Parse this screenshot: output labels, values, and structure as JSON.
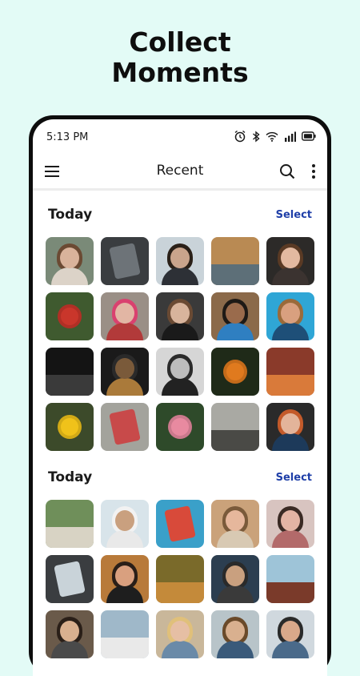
{
  "headline": {
    "line1": "Collect",
    "line2": "Moments"
  },
  "status_bar": {
    "time": "5:13 PM"
  },
  "app_bar": {
    "title": "Recent"
  },
  "sections": [
    {
      "label": "Today",
      "select_label": "Select"
    },
    {
      "label": "Today",
      "select_label": "Select"
    }
  ],
  "colors": {
    "background": "#e3fbf6",
    "phone_frame": "#0d0d0d",
    "select_accent": "#1f3fa8"
  },
  "photos": {
    "section1": [
      {
        "kind": "portrait",
        "bg": "#7a8a78",
        "skin": "#d9b39b",
        "hair": "#6b4a33",
        "shirt": "#dcd3c8"
      },
      {
        "kind": "object",
        "bg": "#3a3d40",
        "fg": "#6d7378"
      },
      {
        "kind": "portrait",
        "bg": "#c9d3d9",
        "skin": "#c9a48c",
        "hair": "#2a2018",
        "shirt": "#2d3036"
      },
      {
        "kind": "scene",
        "bg": "#b98a53",
        "fg": "#5d6f78"
      },
      {
        "kind": "portrait",
        "bg": "#2c2a28",
        "skin": "#e3b9a0",
        "hair": "#5a3a24",
        "shirt": "#3b3330"
      },
      {
        "kind": "flower",
        "bg": "#3f5a2f",
        "fg": "#c9362b"
      },
      {
        "kind": "portrait",
        "bg": "#9a8f86",
        "skin": "#e2b6a4",
        "hair": "#d9416f",
        "shirt": "#b23a3a"
      },
      {
        "kind": "portrait",
        "bg": "#3a3a3a",
        "skin": "#d8b49c",
        "hair": "#6a4a33",
        "shirt": "#1a1a1a"
      },
      {
        "kind": "portrait",
        "bg": "#8b6a4a",
        "skin": "#9a6b4c",
        "hair": "#1e1a16",
        "shirt": "#2f7fc1"
      },
      {
        "kind": "portrait",
        "bg": "#2fa6d6",
        "skin": "#d9a07f",
        "hair": "#9a6a3a",
        "shirt": "#1e4f78"
      },
      {
        "kind": "scene",
        "bg": "#141414",
        "fg": "#3a3a3a"
      },
      {
        "kind": "portrait",
        "bg": "#1a1a1a",
        "skin": "#7a5a3a",
        "hair": "#2a2a2a",
        "shirt": "#aa7a3a"
      },
      {
        "kind": "portrait",
        "bg": "#d6d6d6",
        "skin": "#bdbdbd",
        "hair": "#2b2b2b",
        "shirt": "#222222"
      },
      {
        "kind": "flower",
        "bg": "#1f2a18",
        "fg": "#e07a1e"
      },
      {
        "kind": "scene",
        "bg": "#8a3a2a",
        "fg": "#d97a3a"
      },
      {
        "kind": "flower",
        "bg": "#3c4a2a",
        "fg": "#f0c21a"
      },
      {
        "kind": "object",
        "bg": "#a3a39c",
        "fg": "#c84a4a"
      },
      {
        "kind": "flower",
        "bg": "#2e4a2a",
        "fg": "#e88aa0"
      },
      {
        "kind": "scene",
        "bg": "#a9a9a3",
        "fg": "#4a4a46"
      },
      {
        "kind": "portrait",
        "bg": "#2a2a2a",
        "skin": "#e3b49a",
        "hair": "#c35a2a",
        "shirt": "#1d3a5a"
      }
    ],
    "section2": [
      {
        "kind": "scene",
        "bg": "#6f8f5a",
        "fg": "#d8d3c4"
      },
      {
        "kind": "portrait",
        "bg": "#d8e4ea",
        "skin": "#c9a07f",
        "hair": "#f2f2f2",
        "shirt": "#e9e9e9"
      },
      {
        "kind": "object",
        "bg": "#3aa0c9",
        "fg": "#d84a3a"
      },
      {
        "kind": "portrait",
        "bg": "#caa27a",
        "skin": "#e6b79c",
        "hair": "#7a5a3a",
        "shirt": "#d8c9b3"
      },
      {
        "kind": "portrait",
        "bg": "#d8c4c0",
        "skin": "#e3b4a4",
        "hair": "#3a2a24",
        "shirt": "#b36a6a"
      },
      {
        "kind": "object",
        "bg": "#3a3d40",
        "fg": "#c9d3d9"
      },
      {
        "kind": "portrait",
        "bg": "#b87a3a",
        "skin": "#d9a07f",
        "hair": "#2a1f18",
        "shirt": "#1e1e1e"
      },
      {
        "kind": "scene",
        "bg": "#7a6a2a",
        "fg": "#c48a3a"
      },
      {
        "kind": "portrait",
        "bg": "#2c3e50",
        "skin": "#c9a07f",
        "hair": "#2a2a2a",
        "shirt": "#3a3a3a"
      },
      {
        "kind": "scene",
        "bg": "#9ec4d8",
        "fg": "#7a3a2a"
      },
      {
        "kind": "portrait",
        "bg": "#6a5a4a",
        "skin": "#d9b08f",
        "hair": "#2a1f18",
        "shirt": "#4a4a4a"
      },
      {
        "kind": "scene",
        "bg": "#9fb8c9",
        "fg": "#e9e9e9"
      },
      {
        "kind": "portrait",
        "bg": "#c9b79a",
        "skin": "#e6bfa4",
        "hair": "#e0c07a",
        "shirt": "#6a8aa8"
      },
      {
        "kind": "portrait",
        "bg": "#b8c4c9",
        "skin": "#d9b08f",
        "hair": "#6a4a2a",
        "shirt": "#3a5a7a"
      },
      {
        "kind": "portrait",
        "bg": "#d0d8de",
        "skin": "#d9a88a",
        "hair": "#2a2a2a",
        "shirt": "#4a6a8a"
      }
    ]
  }
}
